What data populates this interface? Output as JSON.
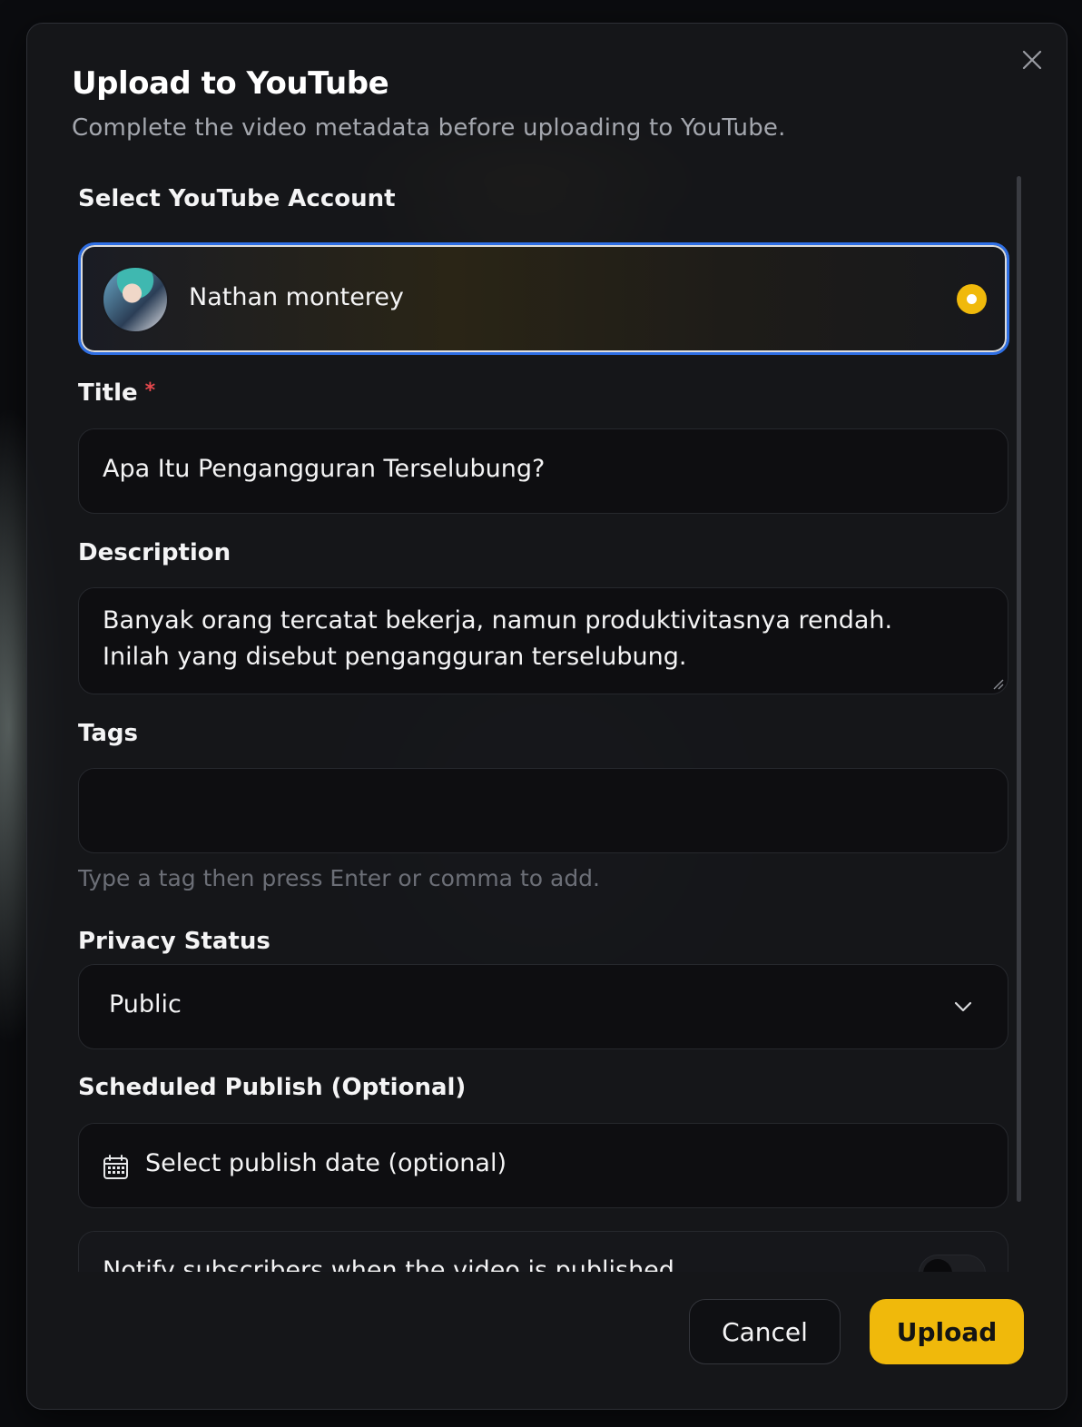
{
  "dialog": {
    "title": "Upload to YouTube",
    "subtitle": "Complete the video metadata before uploading to YouTube."
  },
  "account": {
    "label": "Select YouTube Account",
    "name": "Nathan monterey",
    "selected": true
  },
  "title_field": {
    "label": "Title",
    "required_mark": "*",
    "value": "Apa Itu Pengangguran Terselubung?"
  },
  "description_field": {
    "label": "Description",
    "value_line1": "Banyak orang tercatat bekerja, namun produktivitasnya rendah.",
    "value_line2": "Inilah yang disebut pengangguran terselubung."
  },
  "tags_field": {
    "label": "Tags",
    "value": "",
    "hint": "Type a tag then press Enter or comma to add."
  },
  "privacy_field": {
    "label": "Privacy Status",
    "selected": "Public"
  },
  "schedule_field": {
    "label": "Scheduled Publish (Optional)",
    "placeholder": "Select publish date (optional)"
  },
  "notify": {
    "label": "Notify subscribers when the video is published",
    "enabled": false
  },
  "actions": {
    "cancel_label": "Cancel",
    "upload_label": "Upload"
  },
  "colors": {
    "accent": "#f0b90b",
    "focus_ring": "#2f6fe4",
    "required": "#e5484d"
  },
  "icons": [
    "close-icon",
    "radio-selected-icon",
    "chevron-down-icon",
    "calendar-icon",
    "resize-grip-icon"
  ]
}
